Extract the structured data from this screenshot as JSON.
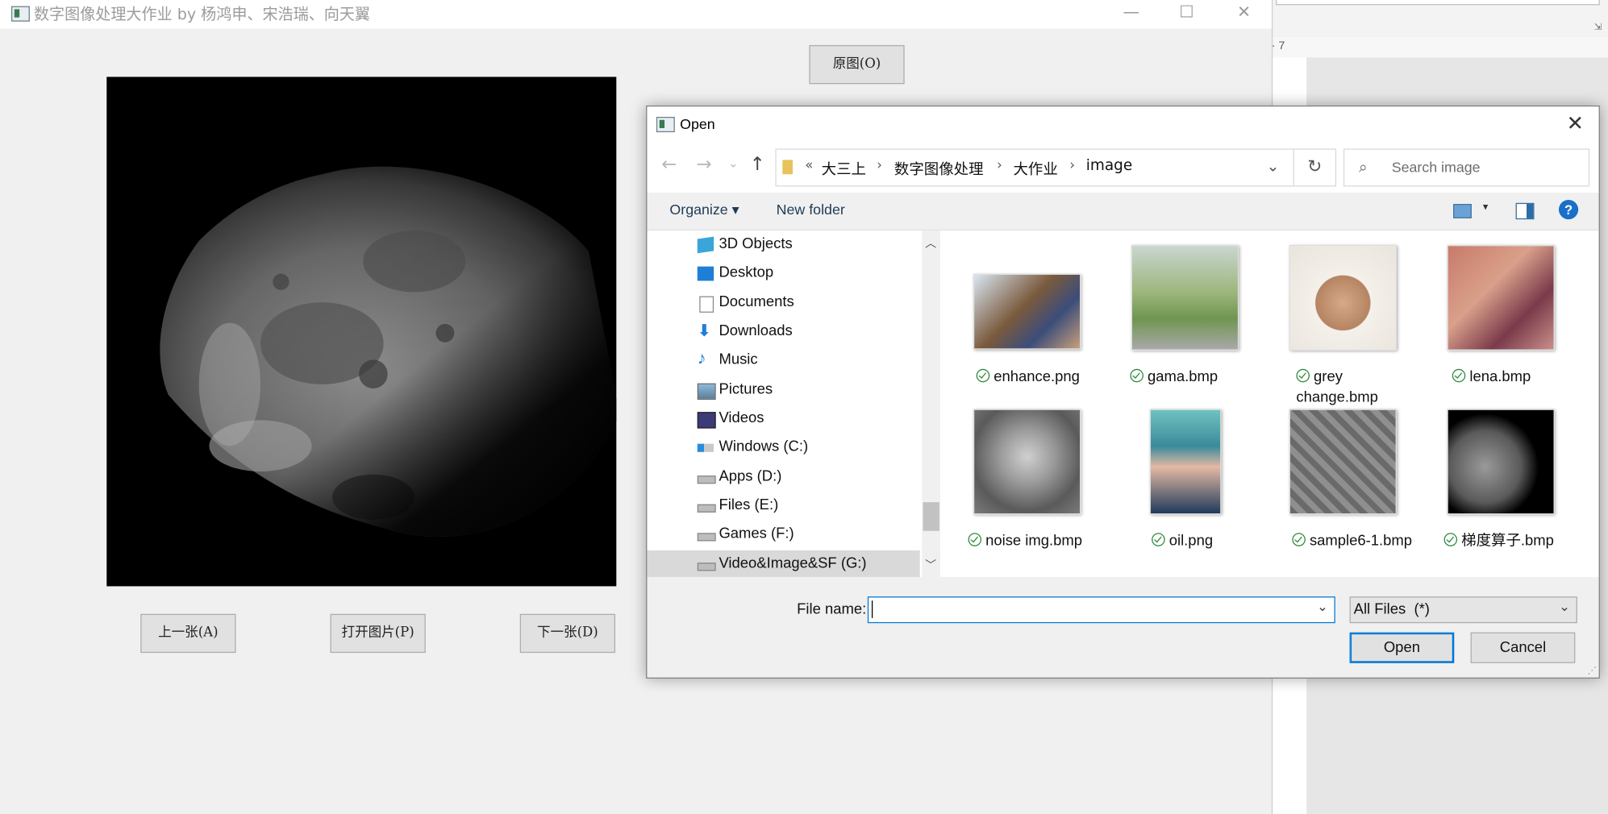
{
  "main_window": {
    "title": "数字图像处理大作业 by 杨鸿申、宋浩瑞、向天翼",
    "buttons": {
      "original": "原图(O)",
      "prev": "上一张(A)",
      "open": "打开图片(P)",
      "next": "下一张(D)"
    },
    "window_controls": {
      "minimize": "—",
      "maximize": "☐",
      "close": "✕"
    }
  },
  "dialog": {
    "title": "Open",
    "close_glyph": "✕",
    "nav": {
      "back": "←",
      "forward": "→",
      "up": "↑",
      "recent": "⌄"
    },
    "breadcrumb": [
      "大三上",
      "数字图像处理",
      "大作业",
      "image"
    ],
    "breadcrumb_overflow": "«",
    "refresh_glyph": "↻",
    "search_placeholder": "Search image",
    "toolbar": {
      "organize": "Organize ▾",
      "new_folder": "New folder"
    },
    "nav_items": [
      {
        "label": "3D Objects",
        "icon": "cube-icon"
      },
      {
        "label": "Desktop",
        "icon": "desktop-icon"
      },
      {
        "label": "Documents",
        "icon": "document-icon"
      },
      {
        "label": "Downloads",
        "icon": "download-icon"
      },
      {
        "label": "Music",
        "icon": "music-icon"
      },
      {
        "label": "Pictures",
        "icon": "pictures-icon"
      },
      {
        "label": "Videos",
        "icon": "video-icon"
      },
      {
        "label": "Windows (C:)",
        "icon": "windows-drive-icon"
      },
      {
        "label": "Apps (D:)",
        "icon": "drive-icon"
      },
      {
        "label": "Files (E:)",
        "icon": "drive-icon"
      },
      {
        "label": "Games (F:)",
        "icon": "drive-icon"
      },
      {
        "label": "Video&Image&SF (G:)",
        "icon": "drive-icon",
        "selected": true
      }
    ],
    "files": [
      {
        "name": "enhance.png"
      },
      {
        "name": "gama.bmp"
      },
      {
        "name": "grey change.bmp"
      },
      {
        "name": "lena.bmp"
      },
      {
        "name": "noise img.bmp"
      },
      {
        "name": "oil.png"
      },
      {
        "name": "sample6-1.bmp"
      },
      {
        "name": "梯度算子.bmp"
      }
    ],
    "file_name_label": "File name:",
    "file_name_value": "",
    "file_type": "All Files  (*)",
    "open_button": "Open",
    "cancel_button": "Cancel"
  },
  "background_app": {
    "ruler_text": "· 7"
  }
}
